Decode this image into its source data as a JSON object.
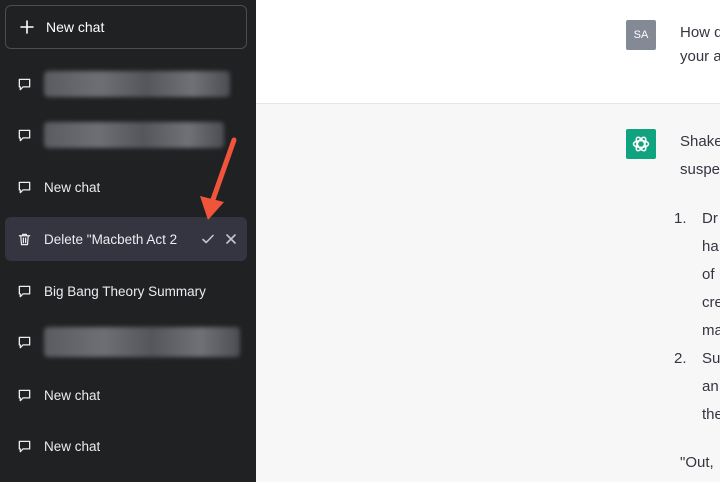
{
  "sidebar": {
    "new_chat_button": "New chat",
    "items": [
      {
        "label": "",
        "redacted": true
      },
      {
        "label": "",
        "redacted": true
      },
      {
        "label": "New chat"
      },
      {
        "label": "Delete \"Macbeth Act 2",
        "confirm_delete": true
      },
      {
        "label": "Big Bang Theory Summary"
      },
      {
        "label": "",
        "redacted": true
      },
      {
        "label": "New chat"
      },
      {
        "label": "New chat"
      }
    ]
  },
  "conversation": {
    "user": {
      "avatar_initials": "SA",
      "lines": [
        "How d",
        "your a"
      ]
    },
    "assistant": {
      "lines": [
        "Shake",
        "suspe"
      ],
      "list": [
        {
          "number": "1.",
          "lines": [
            "Dr",
            "ha",
            "of",
            "cre",
            "ma"
          ]
        },
        {
          "number": "2.",
          "lines": [
            "Su",
            "an",
            "the"
          ]
        }
      ],
      "quote": "\"Out,"
    }
  },
  "colors": {
    "sidebar_bg": "#202123",
    "active_item_bg": "#343541",
    "assistant_brand": "#10a37f",
    "arrow": "#f0553c"
  }
}
